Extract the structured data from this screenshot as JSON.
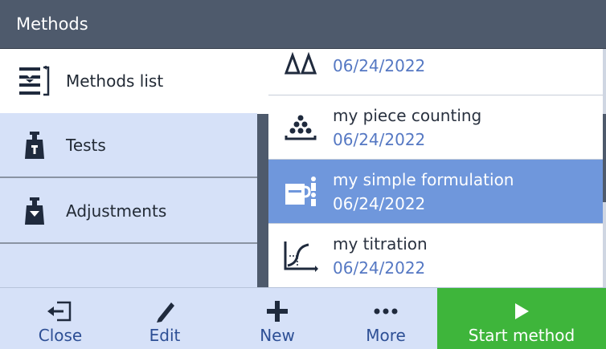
{
  "window": {
    "title": "Methods"
  },
  "sidebar": {
    "items": [
      {
        "label": "Methods list",
        "icon": "methods-list-icon"
      },
      {
        "label": "Tests",
        "icon": "test-weight-icon"
      },
      {
        "label": "Adjustments",
        "icon": "adjustment-weight-icon"
      }
    ]
  },
  "methods": {
    "rows": [
      {
        "name": "",
        "date": "06/24/2022",
        "icon": "delta-delta-icon"
      },
      {
        "name": "my piece counting",
        "date": "06/24/2022",
        "icon": "piece-counting-icon"
      },
      {
        "name": "my simple formulation",
        "date": "06/24/2022",
        "icon": "formulation-icon",
        "selected": true
      },
      {
        "name": "my titration",
        "date": "06/24/2022",
        "icon": "titration-icon"
      }
    ]
  },
  "toolbar": {
    "close_label": "Close",
    "edit_label": "Edit",
    "new_label": "New",
    "more_label": "More",
    "start_label": "Start method"
  },
  "colors": {
    "titlebar": "#4e5a6c",
    "sidebar": "#d6e1f8",
    "selected": "#6f97dc",
    "accent_text": "#2d4f95",
    "start": "#3eb53b"
  }
}
